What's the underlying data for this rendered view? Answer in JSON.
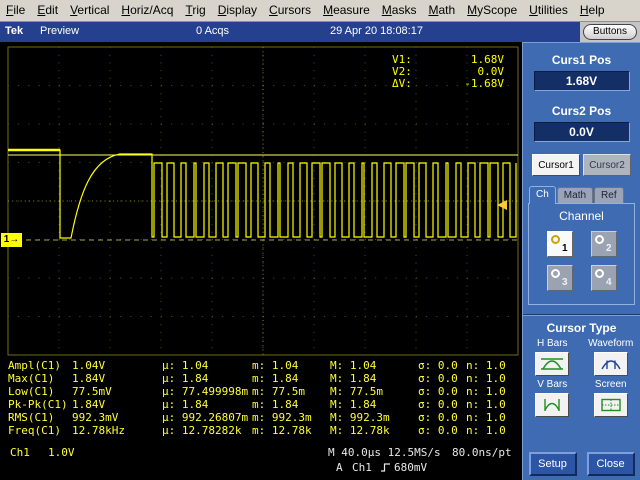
{
  "menu": {
    "items": [
      "File",
      "Edit",
      "Vertical",
      "Horiz/Acq",
      "Trig",
      "Display",
      "Cursors",
      "Measure",
      "Masks",
      "Math",
      "MyScope",
      "Utilities",
      "Help"
    ]
  },
  "titlebar": {
    "brand": "Tek",
    "mode": "Preview",
    "acqs": "0 Acqs",
    "datetime": "29 Apr 20 18:08:17",
    "buttons_label": "Buttons"
  },
  "readout": {
    "v1_label": "V1:",
    "v1_value": "1.68V",
    "v2_label": "V2:",
    "v2_value": "0.0V",
    "dv_label": "ΔV:",
    "dv_value": "-1.68V"
  },
  "marker": {
    "ch1": "1→"
  },
  "measurements": {
    "rows": [
      {
        "name": "Ampl(C1)",
        "value": "1.04V",
        "mean": "µ: 1.04",
        "min": "m: 1.04",
        "max": "M: 1.04",
        "sigma": "σ: 0.0",
        "count": "n: 1.0"
      },
      {
        "name": "Max(C1)",
        "value": "1.84V",
        "mean": "µ: 1.84",
        "min": "m: 1.84",
        "max": "M: 1.84",
        "sigma": "σ: 0.0",
        "count": "n: 1.0"
      },
      {
        "name": "Low(C1)",
        "value": "77.5mV",
        "mean": "µ: 77.499998m",
        "min": "m: 77.5m",
        "max": "M: 77.5m",
        "sigma": "σ: 0.0",
        "count": "n: 1.0"
      },
      {
        "name": "Pk-Pk(C1)",
        "value": "1.84V",
        "mean": "µ: 1.84",
        "min": "m: 1.84",
        "max": "M: 1.84",
        "sigma": "σ: 0.0",
        "count": "n: 1.0"
      },
      {
        "name": "RMS(C1)",
        "value": "992.3mV",
        "mean": "µ: 992.26807m",
        "min": "m: 992.3m",
        "max": "M: 992.3m",
        "sigma": "σ: 0.0",
        "count": "n: 1.0"
      },
      {
        "name": "Freq(C1)",
        "value": "12.78kHz",
        "mean": "µ: 12.78282k",
        "min": "m: 12.78k",
        "max": "M: 12.78k",
        "sigma": "σ: 0.0",
        "count": "n: 1.0"
      }
    ]
  },
  "status": {
    "ch_label": "Ch1",
    "ch_scale": "1.0V",
    "timebase": "M 40.0µs 12.5MS/s",
    "sample": "80.0ns/pt",
    "trig_mode": "A",
    "trig_src": "Ch1",
    "trig_level": "680mV"
  },
  "panel": {
    "curs1_label": "Curs1 Pos",
    "curs1_value": "1.68V",
    "curs2_label": "Curs2 Pos",
    "curs2_value": "0.0V",
    "cursor1_btn": "Cursor1",
    "cursor2_btn": "Cursor2",
    "tabs": [
      "Ch",
      "Math",
      "Ref"
    ],
    "channel_label": "Channel",
    "channels": [
      "1",
      "2",
      "3",
      "4"
    ],
    "cursor_type_label": "Cursor Type",
    "hbars_label": "H Bars",
    "waveform_label": "Waveform",
    "vbars_label": "V Bars",
    "screen_label": "Screen",
    "setup_btn": "Setup",
    "close_btn": "Close"
  },
  "colors": {
    "trace": "#ffff00",
    "panel_blue": "#3e6bb2",
    "titlebar_blue": "#24408e",
    "icon_green": "#1f8f1f"
  }
}
